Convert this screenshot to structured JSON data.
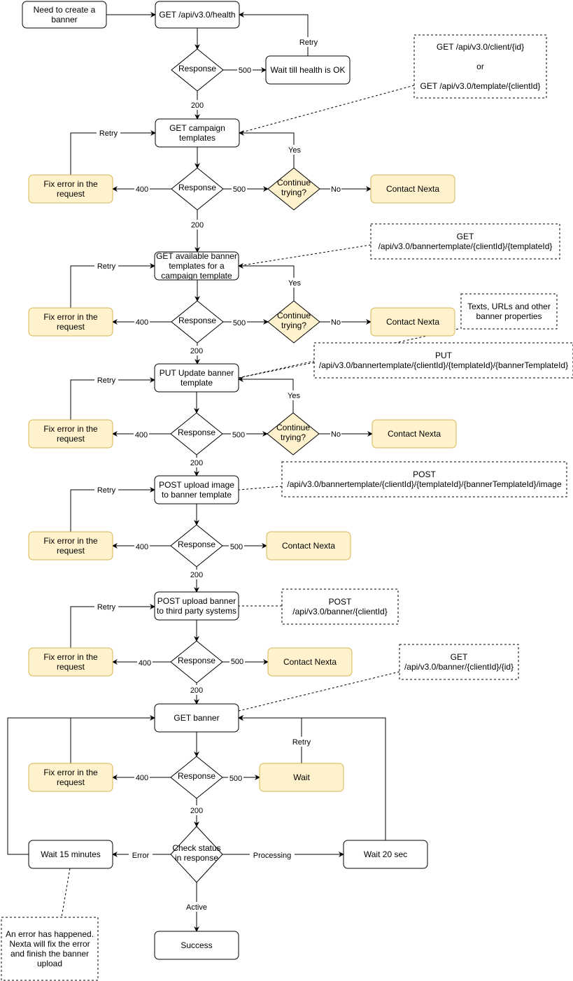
{
  "colors": {
    "stroke": "#000000",
    "highlight_fill": "#fff2cc",
    "highlight_stroke": "#d6b656",
    "background": "#ffffff"
  },
  "nodes": {
    "start": {
      "lines": [
        "Need to create a",
        "banner"
      ],
      "shape": "process"
    },
    "health": {
      "lines": [
        "GET /api/v3.0/health"
      ],
      "shape": "process"
    },
    "resp1": {
      "lines": [
        "Response"
      ],
      "shape": "decision"
    },
    "waitHealth": {
      "lines": [
        "Wait till health is OK"
      ],
      "shape": "process"
    },
    "note1": {
      "lines": [
        "GET  /api/v3.0/client/{id}",
        "",
        "or",
        "",
        "GET /api/v3.0/template/{clientId}"
      ],
      "shape": "note"
    },
    "campaign": {
      "lines": [
        "GET campaign",
        "templates"
      ],
      "shape": "process"
    },
    "resp2": {
      "lines": [
        "Response"
      ],
      "shape": "decision"
    },
    "fix2": {
      "lines": [
        "Fix error in the",
        "request"
      ],
      "shape": "highlight"
    },
    "cont2": {
      "lines": [
        "Continue",
        "trying?"
      ],
      "shape": "highlight-decision"
    },
    "contact2": {
      "lines": [
        "Contact Nexta"
      ],
      "shape": "highlight"
    },
    "note2": {
      "lines": [
        "GET",
        "/api/v3.0/bannertemplate/{clientId}/{templateId}"
      ],
      "shape": "note"
    },
    "avail": {
      "lines": [
        "GET available banner",
        "templates for a",
        "campaign template"
      ],
      "shape": "process"
    },
    "resp3": {
      "lines": [
        "Response"
      ],
      "shape": "decision"
    },
    "fix3": {
      "lines": [
        "Fix error in the",
        "request"
      ],
      "shape": "highlight"
    },
    "cont3": {
      "lines": [
        "Continue",
        "trying?"
      ],
      "shape": "highlight-decision"
    },
    "contact3": {
      "lines": [
        "Contact Nexta"
      ],
      "shape": "highlight"
    },
    "note3": {
      "lines": [
        "Texts, URLs and other",
        "banner properties"
      ],
      "shape": "note"
    },
    "note4": {
      "lines": [
        "PUT",
        "/api/v3.0/bannertemplate/{clientId}/{templateId}/{bannerTemplateId}"
      ],
      "shape": "note"
    },
    "put": {
      "lines": [
        "PUT Update banner",
        "template"
      ],
      "shape": "process"
    },
    "resp4": {
      "lines": [
        "Response"
      ],
      "shape": "decision"
    },
    "fix4": {
      "lines": [
        "Fix error in the",
        "request"
      ],
      "shape": "highlight"
    },
    "cont4": {
      "lines": [
        "Continue",
        "trying?"
      ],
      "shape": "highlight-decision"
    },
    "contact4": {
      "lines": [
        "Contact Nexta"
      ],
      "shape": "highlight"
    },
    "note5": {
      "lines": [
        "POST",
        "/api/v3.0/bannertemplate/{clientId}/{templateId}/{bannerTemplateId}/image"
      ],
      "shape": "note"
    },
    "postimg": {
      "lines": [
        "POST upload image",
        "to banner template"
      ],
      "shape": "process"
    },
    "resp5": {
      "lines": [
        "Response"
      ],
      "shape": "decision"
    },
    "fix5": {
      "lines": [
        "Fix error in the",
        "request"
      ],
      "shape": "highlight"
    },
    "contact5": {
      "lines": [
        "Contact Nexta"
      ],
      "shape": "highlight"
    },
    "postbanner": {
      "lines": [
        "POST upload banner",
        "to third party systems"
      ],
      "shape": "process"
    },
    "note6": {
      "lines": [
        "POST",
        "/api/v3.0/banner/{clientId}"
      ],
      "shape": "note"
    },
    "resp6": {
      "lines": [
        "Response"
      ],
      "shape": "decision"
    },
    "fix6": {
      "lines": [
        "Fix error in the",
        "request"
      ],
      "shape": "highlight"
    },
    "contact6": {
      "lines": [
        "Contact Nexta"
      ],
      "shape": "highlight"
    },
    "note7": {
      "lines": [
        "GET",
        "/api/v3.0/banner/{clientId}/{id}"
      ],
      "shape": "note"
    },
    "getbanner": {
      "lines": [
        "GET banner"
      ],
      "shape": "process"
    },
    "resp7": {
      "lines": [
        "Response"
      ],
      "shape": "decision"
    },
    "fix7": {
      "lines": [
        "Fix error in the",
        "request"
      ],
      "shape": "highlight"
    },
    "wait": {
      "lines": [
        "Wait"
      ],
      "shape": "highlight"
    },
    "check": {
      "lines": [
        "Check status",
        "in response"
      ],
      "shape": "decision"
    },
    "wait15": {
      "lines": [
        "Wait 15 minutes"
      ],
      "shape": "process"
    },
    "wait20": {
      "lines": [
        "Wait 20 sec"
      ],
      "shape": "process"
    },
    "success": {
      "lines": [
        "Success"
      ],
      "shape": "process"
    },
    "note8": {
      "lines": [
        "An error has happened.",
        "Nexta will fix the error",
        "and finish the banner",
        "upload"
      ],
      "shape": "note"
    }
  },
  "edges": {
    "e_start_health": {
      "label": ""
    },
    "e_health_resp1": {
      "label": ""
    },
    "e_resp1_wait": {
      "label": "500"
    },
    "e_wait_health": {
      "label": "Retry"
    },
    "e_resp1_campaign": {
      "label": "200"
    },
    "e_resp2_fix": {
      "label": "400"
    },
    "e_resp2_cont": {
      "label": "500"
    },
    "e_cont2_contact": {
      "label": "No"
    },
    "e_cont2_yes": {
      "label": "Yes"
    },
    "e_fix2_retry": {
      "label": "Retry"
    },
    "e_resp2_avail": {
      "label": "200"
    },
    "e_resp3_fix": {
      "label": "400"
    },
    "e_resp3_cont": {
      "label": "500"
    },
    "e_cont3_contact": {
      "label": "No"
    },
    "e_cont3_yes": {
      "label": "Yes"
    },
    "e_fix3_retry": {
      "label": "Retry"
    },
    "e_resp3_put": {
      "label": "200"
    },
    "e_resp4_fix": {
      "label": "400"
    },
    "e_resp4_cont": {
      "label": "500"
    },
    "e_cont4_contact": {
      "label": "No"
    },
    "e_cont4_yes": {
      "label": "Yes"
    },
    "e_fix4_retry": {
      "label": "Retry"
    },
    "e_resp4_postimg": {
      "label": "200"
    },
    "e_postimg_resp5": {
      "label": ""
    },
    "e_resp5_fix": {
      "label": "400"
    },
    "e_resp5_contact": {
      "label": "500"
    },
    "e_fix5_retry": {
      "label": "Retry"
    },
    "e_resp5_postbanner": {
      "label": "200"
    },
    "e_postbanner_resp6": {
      "label": ""
    },
    "e_resp6_fix": {
      "label": "400"
    },
    "e_resp6_contact": {
      "label": "500"
    },
    "e_fix6_retry": {
      "label": "Retry"
    },
    "e_resp6_getbanner": {
      "label": "200"
    },
    "e_getbanner_resp7": {
      "label": ""
    },
    "e_resp7_fix": {
      "label": "400"
    },
    "e_resp7_wait": {
      "label": "500"
    },
    "e_fix7_retry": {
      "label": ""
    },
    "e_wait_retry": {
      "label": "Retry"
    },
    "e_resp7_check": {
      "label": "200"
    },
    "e_check_error": {
      "label": "Error"
    },
    "e_check_processing": {
      "label": "Processing"
    },
    "e_check_active": {
      "label": "Active"
    },
    "e_wait20_back": {
      "label": ""
    },
    "e_wait15_back": {
      "label": ""
    },
    "e_campaign_resp2": {
      "label": ""
    },
    "e_avail_resp3": {
      "label": ""
    },
    "e_put_resp4": {
      "label": ""
    }
  }
}
